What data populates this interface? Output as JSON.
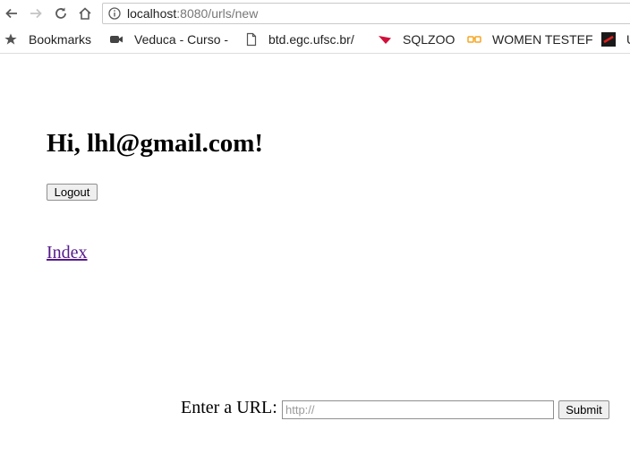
{
  "browser": {
    "url_host": "localhost",
    "url_rest": ":8080/urls/new",
    "bookmarks": [
      {
        "label": "Bookmarks",
        "icon": "star-icon"
      },
      {
        "label": "Veduca - Curso -",
        "icon": "video-icon"
      },
      {
        "label": "btd.egc.ufsc.br/",
        "icon": "page-icon"
      },
      {
        "label": "SQLZOO",
        "icon": "sqlzoo-icon"
      },
      {
        "label": "WOMEN TESTEF",
        "icon": "glasses-icon"
      },
      {
        "label": "U",
        "icon": "flag-icon"
      }
    ]
  },
  "page": {
    "greeting": "Hi, lhl@gmail.com!",
    "logout_label": "Logout",
    "index_link": "Index",
    "url_label": "Enter a URL:",
    "url_placeholder": "http://",
    "submit_label": "Submit"
  },
  "colors": {
    "visited_link": "#551a8b",
    "sqlzoo_red": "#d0103a",
    "women_tester_orange": "#f5a623"
  }
}
